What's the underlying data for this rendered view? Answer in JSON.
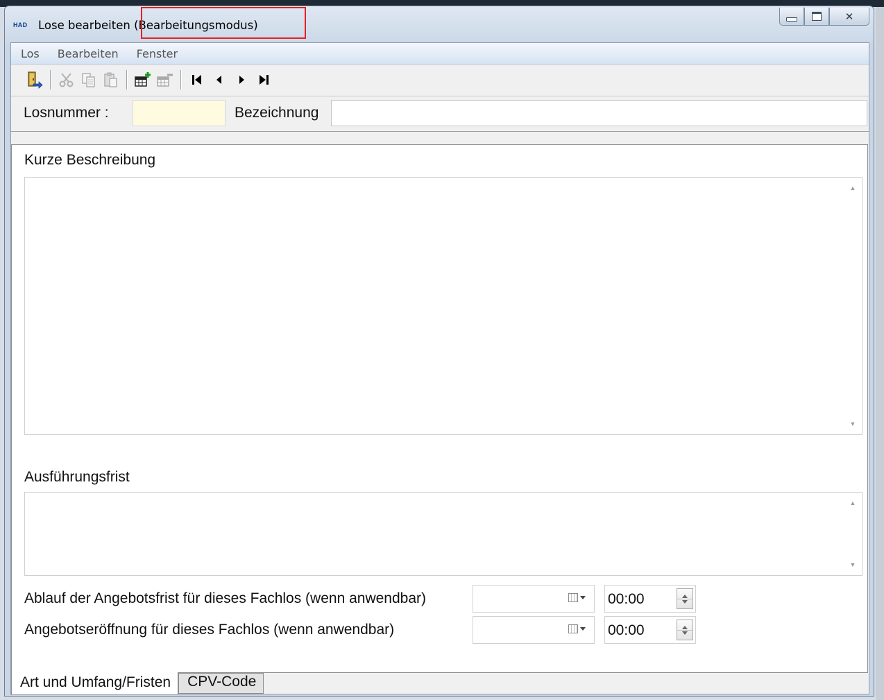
{
  "window": {
    "logo": "HAD",
    "title": "Lose bearbeiten",
    "mode": "(Bearbeitungsmodus)",
    "highlight_color": "#e52020"
  },
  "menu": [
    "Los",
    "Bearbeiten",
    "Fenster"
  ],
  "toolbar": {
    "buttons": [
      "exit-icon",
      "cut-icon",
      "copy-icon",
      "paste-icon",
      "add-record-icon",
      "delete-record-icon",
      "first-record-icon",
      "previous-record-icon",
      "next-record-icon",
      "last-record-icon"
    ]
  },
  "header": {
    "losnummer_label": "Losnummer :",
    "losnummer_value": "",
    "bezeichnung_label": "Bezeichnung",
    "bezeichnung_value": ""
  },
  "form": {
    "kurze_beschreibung_label": "Kurze Beschreibung",
    "kurze_beschreibung_value": "",
    "ausfuehrungsfrist_label": "Ausführungsfrist",
    "ausfuehrungsfrist_value": "",
    "angebotsfrist_label": "Ablauf der Angebotsfrist für dieses Fachlos (wenn anwendbar)",
    "angebotsfrist_date": "",
    "angebotsfrist_time": "00:00",
    "angebotseroeffnung_label": "Angebotseröffnung für dieses Fachlos (wenn anwendbar)",
    "angebotseroeffnung_date": "",
    "angebotseroeffnung_time": "00:00"
  },
  "tabs": [
    {
      "label": "Art und Umfang/Fristen",
      "active": true
    },
    {
      "label": "CPV-Code",
      "active": false
    }
  ]
}
